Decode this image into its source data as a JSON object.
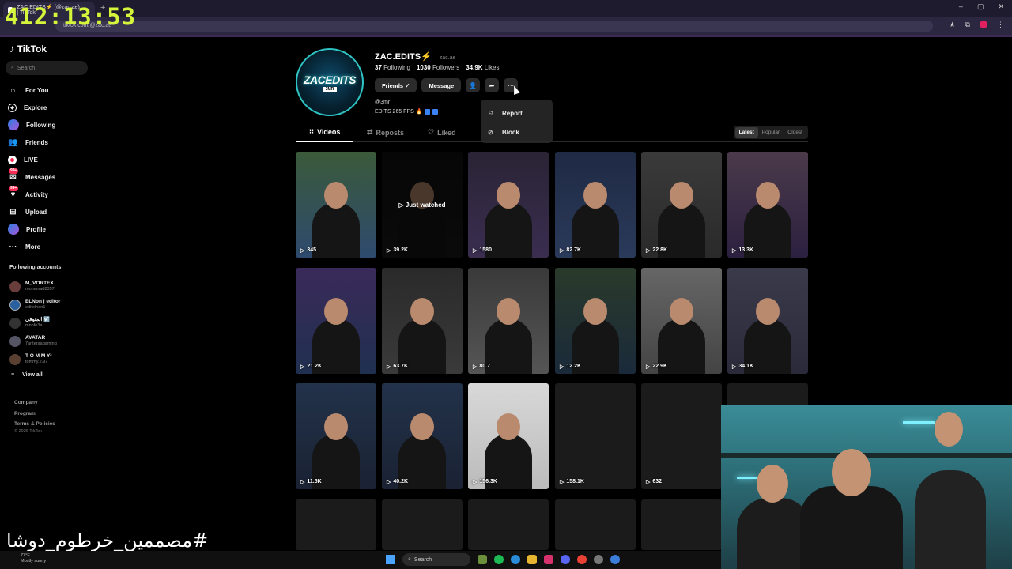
{
  "browser": {
    "tab_title": "ZAC.EDITS⚡ (@zac.ae) | TikTok",
    "url": "tiktok.com/@zac.ae",
    "timer": "412:13:53"
  },
  "sidebar": {
    "logo": "TikTok",
    "search_placeholder": "Search",
    "nav": [
      {
        "label": "For You",
        "icon": "home-icon"
      },
      {
        "label": "Explore",
        "icon": "compass-icon"
      },
      {
        "label": "Following",
        "icon": "following-avatar-icon"
      },
      {
        "label": "Friends",
        "icon": "friends-icon"
      },
      {
        "label": "LIVE",
        "icon": "live-icon"
      },
      {
        "label": "Messages",
        "icon": "messages-icon",
        "badge": "99+"
      },
      {
        "label": "Activity",
        "icon": "activity-icon",
        "badge": "99+"
      },
      {
        "label": "Upload",
        "icon": "upload-icon"
      },
      {
        "label": "Profile",
        "icon": "profile-icon"
      },
      {
        "label": "More",
        "icon": "more-icon"
      }
    ],
    "following_title": "Following accounts",
    "accounts": [
      {
        "name": "M_VORTEX",
        "handle": "mohamad8357"
      },
      {
        "name": "ELNon | editor",
        "handle": "editelnon1"
      },
      {
        "name": "المتوفي ☑️",
        "handle": "mnofe3a"
      },
      {
        "name": "AVATAR",
        "handle": "7anteraagaming"
      },
      {
        "name": "T O M M Y²",
        "handle": "tommy.2.97"
      }
    ],
    "view_all": "View all",
    "footer_links": [
      "Company",
      "Program",
      "Terms & Policies"
    ],
    "copyright": "© 2026 TikTok"
  },
  "profile": {
    "display_name": "ZAC.EDITS⚡",
    "handle": "zac.ae",
    "avatar_text": "ZACEDITS",
    "avatar_sub": "3MR",
    "following_count": "37",
    "following_label": "Following",
    "followers_count": "1030",
    "followers_label": "Followers",
    "likes_count": "34.9K",
    "likes_label": "Likes",
    "friends_btn": "Friends ✓",
    "message_btn": "Message",
    "bio_handle": "@3mr",
    "bio_text": "EDITS 265 FPS 🔥"
  },
  "dropdown": {
    "items": [
      {
        "label": "Report",
        "icon": "flag-icon"
      },
      {
        "label": "Block",
        "icon": "block-icon"
      }
    ]
  },
  "tabs": {
    "videos": "Videos",
    "reposts": "Reposts",
    "liked": "Liked",
    "sort": [
      "Latest",
      "Popular",
      "Oldest"
    ],
    "sort_active": "Latest"
  },
  "videos": [
    {
      "views": "345"
    },
    {
      "views": "39.2K",
      "overlay": "▷ Just watched"
    },
    {
      "views": "1580"
    },
    {
      "views": "82.7K"
    },
    {
      "views": "22.8K"
    },
    {
      "views": "13.3K"
    },
    {
      "views": "21.2K"
    },
    {
      "views": "63.7K"
    },
    {
      "views": "80.7"
    },
    {
      "views": "12.2K"
    },
    {
      "views": "22.9K"
    },
    {
      "views": "34.1K"
    },
    {
      "views": "11.5K"
    },
    {
      "views": "40.2K"
    },
    {
      "views": "156.3K"
    },
    {
      "views": "158.1K"
    },
    {
      "views": "632"
    }
  ],
  "overlay_text": {
    "hashtag": "#مصممين_خرطوم_دوشا"
  },
  "taskbar": {
    "weather_temp": "77°F",
    "weather_desc": "Mostly sunny",
    "search": "Search"
  },
  "colors": {
    "accent": "#fe2c55",
    "avatar_ring": "#2ec4c4",
    "timer": "#d5f53a"
  }
}
